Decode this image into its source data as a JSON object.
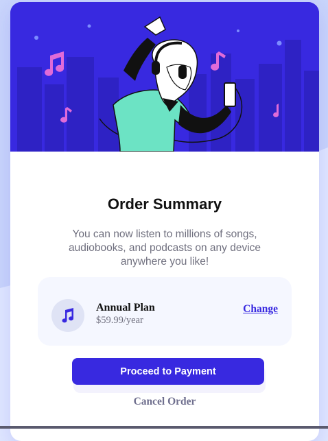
{
  "colors": {
    "page_background": "#e0e8ff",
    "card_background": "#ffffff",
    "hero_background": "#3829e0",
    "accent": "#3829e0",
    "plan_box_background": "#f5f7ff",
    "muted_text": "#6f6f7e",
    "title_text": "#111111"
  },
  "hero": {
    "illustration": "illustration-dancing"
  },
  "summary": {
    "title": "Order Summary",
    "description": "You can now listen to millions of songs, audiobooks, and podcasts on any device anywhere you like!"
  },
  "plan": {
    "icon": "music-note-icon",
    "name": "Annual Plan",
    "price": "$59.99/year",
    "change_label": "Change"
  },
  "actions": {
    "proceed_label": "Proceed to Payment",
    "cancel_label": "Cancel Order"
  }
}
